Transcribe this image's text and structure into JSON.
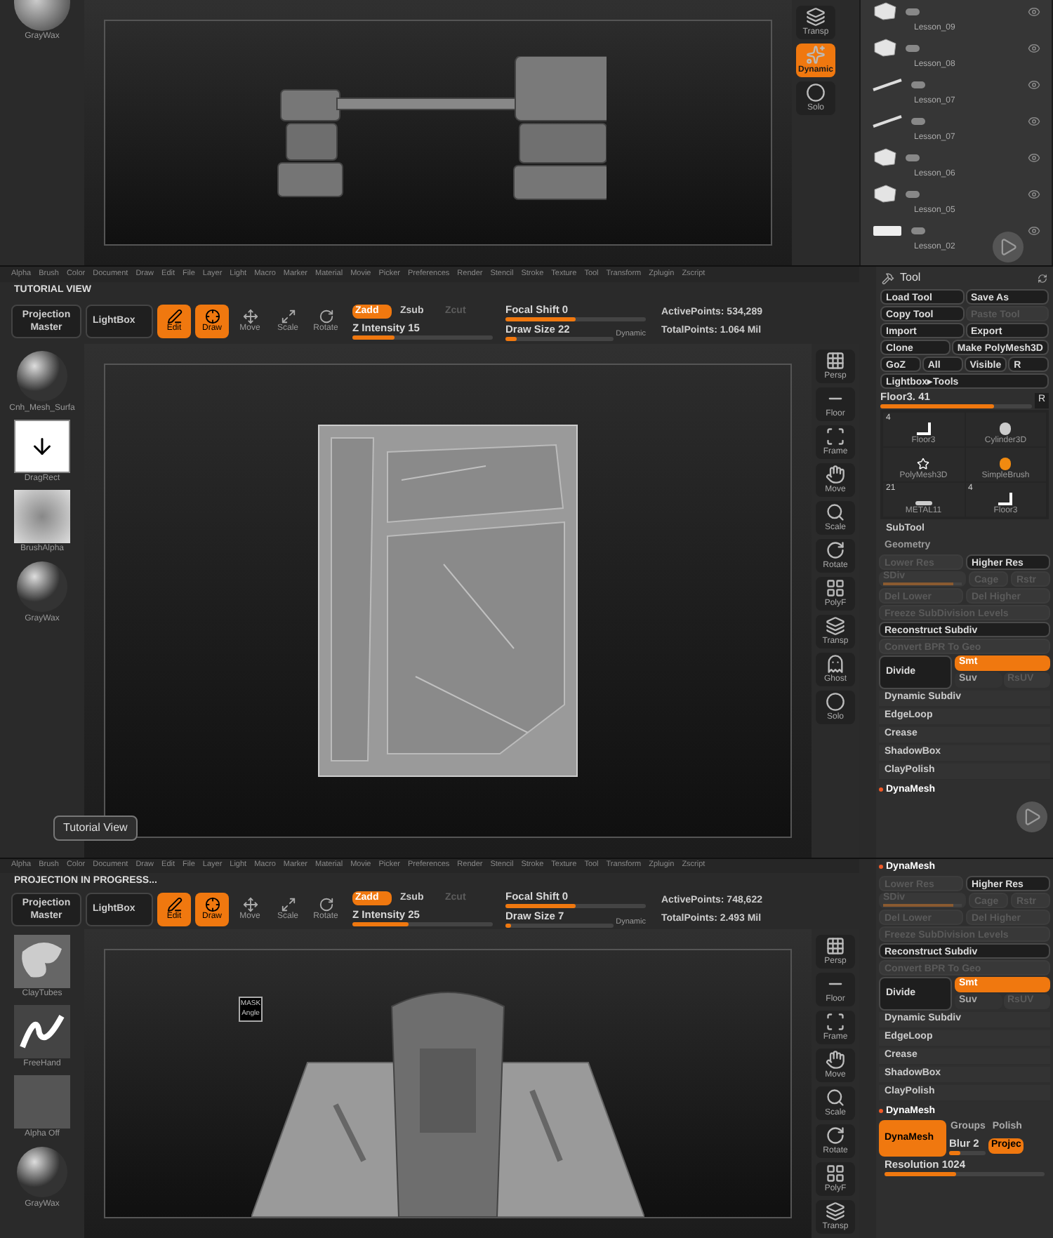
{
  "top_view": {
    "brush_tray": [
      {
        "label": "GrayWax",
        "kind": "sphere"
      }
    ],
    "shelf": [
      {
        "label": "Transp",
        "kind": "transp",
        "selected": false
      },
      {
        "label": "Dynamic",
        "kind": "dynamic",
        "selected": true
      },
      {
        "label": "Solo",
        "kind": "solo",
        "selected": false
      }
    ],
    "subtools": [
      {
        "name": "Lesson_09",
        "kind": "cube"
      },
      {
        "name": "Lesson_08",
        "kind": "cube"
      },
      {
        "name": "Lesson_07",
        "kind": "rod"
      },
      {
        "name": "Lesson_07",
        "kind": "rod"
      },
      {
        "name": "Lesson_06",
        "kind": "cube"
      },
      {
        "name": "Lesson_05",
        "kind": "cube"
      },
      {
        "name": "Lesson_02",
        "kind": "slab"
      }
    ]
  },
  "tutorial_view": {
    "menu": [
      "Alpha",
      "Brush",
      "Color",
      "Document",
      "Draw",
      "Edit",
      "File",
      "Layer",
      "Light",
      "Macro",
      "Marker",
      "Material",
      "Movie",
      "Picker",
      "Preferences",
      "Render",
      "Stencil",
      "Stroke",
      "Texture",
      "Tool",
      "Transform",
      "Zplugin",
      "Zscript"
    ],
    "status": "TUTORIAL VIEW",
    "toolbar": {
      "projection_master": "Projection Master",
      "lightbox": "LightBox",
      "modes": [
        {
          "label": "Edit",
          "kind": "edit",
          "selected": true
        },
        {
          "label": "Draw",
          "kind": "draw",
          "selected": true
        },
        {
          "label": "Move",
          "kind": "move",
          "selected": false
        },
        {
          "label": "Scale",
          "kind": "scale",
          "selected": false
        },
        {
          "label": "Rotate",
          "kind": "rotate",
          "selected": false
        }
      ],
      "z_modes": [
        {
          "label": "Zadd",
          "selected": true,
          "disabled": false
        },
        {
          "label": "Zsub",
          "selected": false,
          "disabled": false
        },
        {
          "label": "Zcut",
          "selected": false,
          "disabled": true
        }
      ],
      "z_intensity": {
        "label": "Z Intensity 15",
        "level": 0.3
      },
      "focal_shift": {
        "label": "Focal Shift 0",
        "level": 0.5
      },
      "draw_size": {
        "label": "Draw Size 22",
        "level": 0.1
      },
      "dynamic": "Dynamic",
      "stats": [
        "ActivePoints: 534,289",
        "TotalPoints: 1.064 Mil"
      ]
    },
    "brush_tray": [
      {
        "label": "Cnh_Mesh_Surfa",
        "kind": "sphere"
      },
      {
        "label": "DragRect",
        "kind": "arrow"
      },
      {
        "label": "BrushAlpha",
        "kind": "alpha"
      },
      {
        "label": "GrayWax",
        "kind": "sphere"
      }
    ],
    "shelf": [
      {
        "label": "Persp",
        "kind": "persp",
        "selected": false
      },
      {
        "label": "Floor",
        "kind": "floor",
        "selected": false
      },
      {
        "label": "Frame",
        "kind": "frame",
        "selected": false
      },
      {
        "label": "Move",
        "kind": "move",
        "selected": false
      },
      {
        "label": "Scale",
        "kind": "scale",
        "selected": false
      },
      {
        "label": "Rotate",
        "kind": "rotate",
        "selected": false
      },
      {
        "label": "PolyF",
        "kind": "polyf",
        "selected": false
      },
      {
        "label": "Transp",
        "kind": "transp",
        "selected": false
      },
      {
        "label": "Ghost",
        "kind": "ghost",
        "selected": false
      },
      {
        "label": "Solo",
        "kind": "solo",
        "selected": false
      }
    ],
    "tooltip": "Tutorial View",
    "tool_panel": {
      "title": "Tool",
      "rows": [
        [
          {
            "label": "Load Tool",
            "disabled": false
          },
          {
            "label": "Save As",
            "disabled": false
          }
        ],
        [
          {
            "label": "Copy Tool",
            "disabled": false
          },
          {
            "label": "Paste Tool",
            "disabled": true
          }
        ],
        [
          {
            "label": "Import",
            "disabled": false
          },
          {
            "label": "Export",
            "disabled": false
          }
        ],
        [
          {
            "label": "Clone",
            "disabled": false
          },
          {
            "label": "Make PolyMesh3D",
            "disabled": false
          }
        ],
        [
          {
            "label": "GoZ",
            "disabled": false
          },
          {
            "label": "All",
            "disabled": false
          },
          {
            "label": "Visible",
            "disabled": false
          },
          {
            "label": "R",
            "disabled": false
          }
        ],
        [
          {
            "label": "Lightbox▸Tools",
            "disabled": false
          }
        ]
      ],
      "slider": {
        "label": "Floor3. 41",
        "level": 0.75,
        "reset": "R"
      },
      "tools": [
        {
          "label": "Floor3",
          "count": "4",
          "kind": "floor"
        },
        {
          "label": "Cylinder3D",
          "kind": "cylinder"
        },
        {
          "label": "PolyMesh3D",
          "kind": "star"
        },
        {
          "label": "SimpleBrush",
          "kind": "brush"
        },
        {
          "label": "METAL11",
          "count": "21",
          "kind": "bar"
        },
        {
          "label": "Floor3",
          "count": "4",
          "kind": "floor"
        }
      ],
      "subtool": "SubTool"
    },
    "geometry": {
      "title": "Geometry",
      "items": [
        {
          "kind": "pair",
          "buttons": [
            {
              "label": "Lower Res",
              "disabled": true
            },
            {
              "label": "Higher Res",
              "disabled": false
            }
          ]
        },
        {
          "kind": "sdiv",
          "label": "SDiv",
          "level": 0.9,
          "disabled": true,
          "buttons": [
            {
              "label": "Cage",
              "disabled": true
            },
            {
              "label": "Rstr",
              "disabled": true
            }
          ]
        },
        {
          "kind": "pair",
          "buttons": [
            {
              "label": "Del Lower",
              "disabled": true
            },
            {
              "label": "Del Higher",
              "disabled": true
            }
          ]
        },
        {
          "kind": "button",
          "label": "Freeze SubDivision Levels",
          "disabled": true
        },
        {
          "kind": "button",
          "label": "Reconstruct Subdiv",
          "disabled": false
        },
        {
          "kind": "button",
          "label": "Convert BPR To Geo",
          "disabled": true
        },
        {
          "kind": "divide",
          "label": "Divide",
          "options": [
            {
              "label": "Smt",
              "on": true,
              "disabled": false
            },
            {
              "label": "Suv",
              "on": false,
              "disabled": false
            },
            {
              "label": "RsUV",
              "on": false,
              "disabled": true
            }
          ]
        },
        {
          "kind": "entry",
          "label": "Dynamic Subdiv"
        },
        {
          "kind": "entry",
          "label": "EdgeLoop"
        },
        {
          "kind": "entry",
          "label": "Crease"
        },
        {
          "kind": "entry",
          "label": "ShadowBox"
        },
        {
          "kind": "entry",
          "label": "ClayPolish"
        },
        {
          "kind": "header",
          "label": "DynaMesh"
        }
      ]
    }
  },
  "projection_view": {
    "menu": [
      "Alpha",
      "Brush",
      "Color",
      "Document",
      "Draw",
      "Edit",
      "File",
      "Layer",
      "Light",
      "Macro",
      "Marker",
      "Material",
      "Movie",
      "Picker",
      "Preferences",
      "Render",
      "Stencil",
      "Stroke",
      "Texture",
      "Tool",
      "Transform",
      "Zplugin",
      "Zscript"
    ],
    "status": "PROJECTION IN PROGRESS...",
    "toolbar": {
      "projection_master": "Projection Master",
      "lightbox": "LightBox",
      "modes": [
        {
          "label": "Edit",
          "kind": "edit",
          "selected": true
        },
        {
          "label": "Draw",
          "kind": "draw",
          "selected": true
        },
        {
          "label": "Move",
          "kind": "move",
          "selected": false
        },
        {
          "label": "Scale",
          "kind": "scale",
          "selected": false
        },
        {
          "label": "Rotate",
          "kind": "rotate",
          "selected": false
        }
      ],
      "z_modes": [
        {
          "label": "Zadd",
          "selected": true,
          "disabled": false
        },
        {
          "label": "Zsub",
          "selected": false,
          "disabled": false
        },
        {
          "label": "Zcut",
          "selected": false,
          "disabled": true
        }
      ],
      "z_intensity": {
        "label": "Z Intensity 25",
        "level": 0.4
      },
      "focal_shift": {
        "label": "Focal Shift 0",
        "level": 0.5
      },
      "draw_size": {
        "label": "Draw Size 7",
        "level": 0.05
      },
      "dynamic": "Dynamic",
      "stats": [
        "ActivePoints: 748,622",
        "TotalPoints: 2.493 Mil"
      ]
    },
    "brush_tray": [
      {
        "label": "ClayTubes",
        "kind": "clay"
      },
      {
        "label": "FreeHand",
        "kind": "stroke"
      },
      {
        "label": "Alpha Off",
        "kind": "blank"
      },
      {
        "label": "GrayWax",
        "kind": "sphere"
      }
    ],
    "mask_label": "MASK Angle",
    "shelf": [
      {
        "label": "Persp",
        "kind": "persp",
        "selected": false
      },
      {
        "label": "Floor",
        "kind": "floor",
        "selected": false
      },
      {
        "label": "Frame",
        "kind": "frame",
        "selected": false
      },
      {
        "label": "Move",
        "kind": "move",
        "selected": false
      },
      {
        "label": "Scale",
        "kind": "scale",
        "selected": false
      },
      {
        "label": "Rotate",
        "kind": "rotate",
        "selected": false
      },
      {
        "label": "PolyF",
        "kind": "polyf",
        "selected": false
      },
      {
        "label": "Transp",
        "kind": "transp",
        "selected": false
      }
    ],
    "geometry": {
      "items": [
        {
          "kind": "header",
          "label": "DynaMesh"
        },
        {
          "kind": "pair",
          "buttons": [
            {
              "label": "Lower Res",
              "disabled": true
            },
            {
              "label": "Higher Res",
              "disabled": false
            }
          ]
        },
        {
          "kind": "sdiv",
          "label": "SDiv",
          "level": 0.9,
          "disabled": true,
          "buttons": [
            {
              "label": "Cage",
              "disabled": true
            },
            {
              "label": "Rstr",
              "disabled": true
            }
          ]
        },
        {
          "kind": "pair",
          "buttons": [
            {
              "label": "Del Lower",
              "disabled": true
            },
            {
              "label": "Del Higher",
              "disabled": true
            }
          ]
        },
        {
          "kind": "button",
          "label": "Freeze SubDivision Levels",
          "disabled": true
        },
        {
          "kind": "button",
          "label": "Reconstruct Subdiv",
          "disabled": false
        },
        {
          "kind": "button",
          "label": "Convert BPR To Geo",
          "disabled": true
        },
        {
          "kind": "divide",
          "label": "Divide",
          "options": [
            {
              "label": "Smt",
              "on": true,
              "disabled": false
            },
            {
              "label": "Suv",
              "on": false,
              "disabled": false
            },
            {
              "label": "RsUV",
              "on": false,
              "disabled": true
            }
          ]
        },
        {
          "kind": "entry",
          "label": "Dynamic Subdiv"
        },
        {
          "kind": "entry",
          "label": "EdgeLoop"
        },
        {
          "kind": "entry",
          "label": "Crease"
        },
        {
          "kind": "entry",
          "label": "ShadowBox"
        },
        {
          "kind": "entry",
          "label": "ClayPolish"
        },
        {
          "kind": "header",
          "label": "DynaMesh"
        },
        {
          "kind": "dynamesh",
          "label": "DynaMesh",
          "selected": true,
          "options": [
            {
              "label": "Groups",
              "on": false
            },
            {
              "label": "Polish",
              "on": false
            }
          ],
          "blur": {
            "label": "Blur 2",
            "level": 0.3
          },
          "project": {
            "label": "Projec",
            "on": true
          }
        },
        {
          "kind": "slider",
          "label": "Resolution 1024",
          "level": 0.45
        }
      ]
    }
  }
}
